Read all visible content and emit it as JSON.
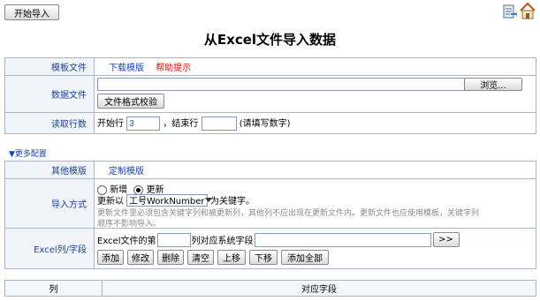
{
  "toolbar": {
    "start_import": "开始导入"
  },
  "page_title": "从Excel文件导入数据",
  "template_row": {
    "label": "模板文件",
    "download": "下载模版",
    "help": "帮助提示"
  },
  "data_file_row": {
    "label": "数据文件",
    "browse": "浏览...",
    "validate": "文件格式校验"
  },
  "read_rows": {
    "label": "读取行数",
    "start_label": "开始行",
    "start_value": "3",
    "end_label": "，结束行",
    "hint": "(请填写数字)"
  },
  "more_config": "▼更多配置",
  "other_template": {
    "label": "其他模版",
    "link": "定制模版"
  },
  "import_mode": {
    "label": "导入方式",
    "option_add": "新增",
    "option_update": "更新",
    "update_by": "更新以",
    "key_field": "工号WorkNumber",
    "as_key": "为关键字。",
    "note_line1": "更新文件里必须包含关键字列和被更新列，其他列不应出现在更新文件内。更新文件也应使用模板，关键字列",
    "note_line2": "顺序不影响导入。"
  },
  "column_map": {
    "label": "Excel列/字段",
    "excel_col_prefix": "Excel文件的第",
    "col_suffix": "列对应系统字段",
    "go": ">>",
    "buttons": {
      "add": "添加",
      "edit": "修改",
      "delete": "删除",
      "clear": "清空",
      "up": "上移",
      "down": "下移",
      "add_all": "添加全部"
    }
  },
  "mapping_table": {
    "col": "列",
    "field": "对应字段"
  }
}
